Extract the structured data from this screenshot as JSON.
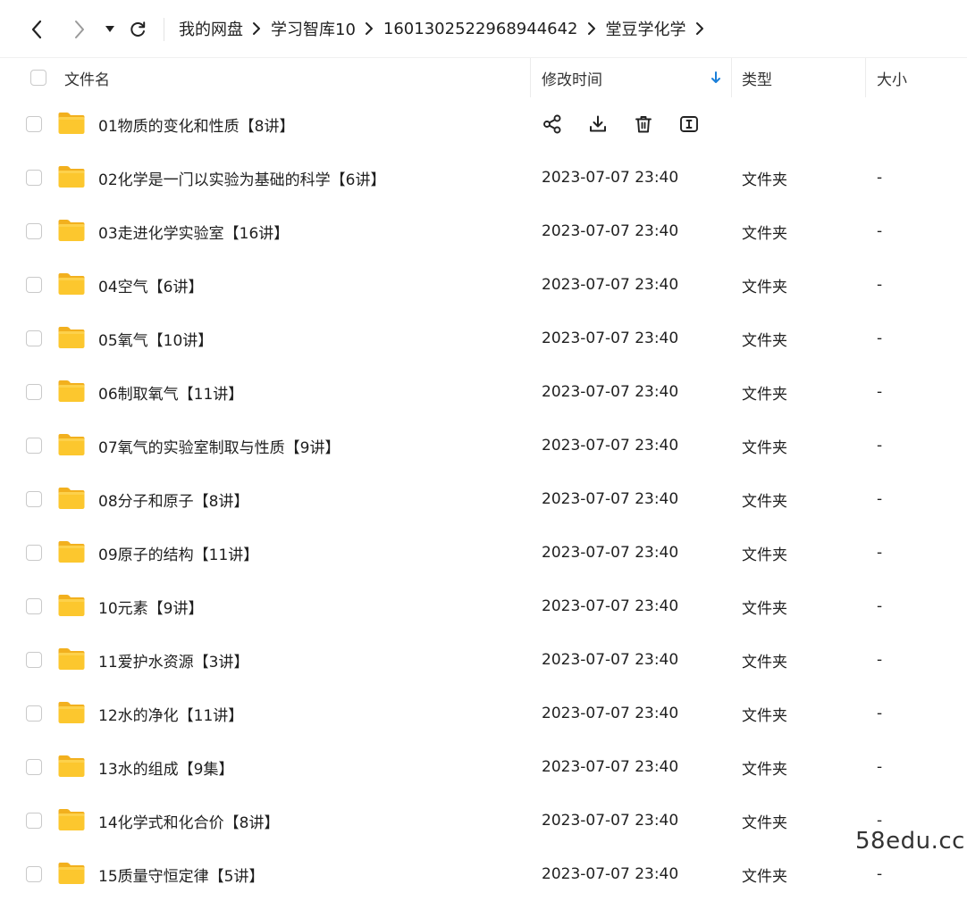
{
  "breadcrumb": [
    "我的网盘",
    "学习智库10",
    "1601302522968944642",
    "堂豆学化学"
  ],
  "columns": {
    "name": "文件名",
    "modified": "修改时间",
    "type": "类型",
    "size": "大小"
  },
  "icons": {
    "back": "chevron-left-icon",
    "forward": "chevron-right-icon",
    "history": "caret-down-icon",
    "refresh": "refresh-icon",
    "sort": "sort-desc-arrow-icon",
    "folder": "folder-icon",
    "share": "share-icon",
    "download": "download-icon",
    "delete": "trash-icon",
    "rename": "rename-icon"
  },
  "colors": {
    "accent": "#1a7fd9",
    "folder": "#fcc72e"
  },
  "files": [
    {
      "name": "01物质的变化和性质【8讲】",
      "modified": "",
      "type": "",
      "size": "",
      "hover": true
    },
    {
      "name": "02化学是一门以实验为基础的科学【6讲】",
      "modified": "2023-07-07 23:40",
      "type": "文件夹",
      "size": "-"
    },
    {
      "name": "03走进化学实验室【16讲】",
      "modified": "2023-07-07 23:40",
      "type": "文件夹",
      "size": "-"
    },
    {
      "name": "04空气【6讲】",
      "modified": "2023-07-07 23:40",
      "type": "文件夹",
      "size": "-"
    },
    {
      "name": "05氧气【10讲】",
      "modified": "2023-07-07 23:40",
      "type": "文件夹",
      "size": "-"
    },
    {
      "name": "06制取氧气【11讲】",
      "modified": "2023-07-07 23:40",
      "type": "文件夹",
      "size": "-"
    },
    {
      "name": "07氧气的实验室制取与性质【9讲】",
      "modified": "2023-07-07 23:40",
      "type": "文件夹",
      "size": "-"
    },
    {
      "name": "08分子和原子【8讲】",
      "modified": "2023-07-07 23:40",
      "type": "文件夹",
      "size": "-"
    },
    {
      "name": "09原子的结构【11讲】",
      "modified": "2023-07-07 23:40",
      "type": "文件夹",
      "size": "-"
    },
    {
      "name": "10元素【9讲】",
      "modified": "2023-07-07 23:40",
      "type": "文件夹",
      "size": "-"
    },
    {
      "name": "11爱护水资源【3讲】",
      "modified": "2023-07-07 23:40",
      "type": "文件夹",
      "size": "-"
    },
    {
      "name": "12水的净化【11讲】",
      "modified": "2023-07-07 23:40",
      "type": "文件夹",
      "size": "-"
    },
    {
      "name": "13水的组成【9集】",
      "modified": "2023-07-07 23:40",
      "type": "文件夹",
      "size": "-"
    },
    {
      "name": "14化学式和化合价【8讲】",
      "modified": "2023-07-07 23:40",
      "type": "文件夹",
      "size": "-"
    },
    {
      "name": "15质量守恒定律【5讲】",
      "modified": "2023-07-07 23:40",
      "type": "文件夹",
      "size": "-"
    }
  ],
  "watermark": "58edu.cc"
}
